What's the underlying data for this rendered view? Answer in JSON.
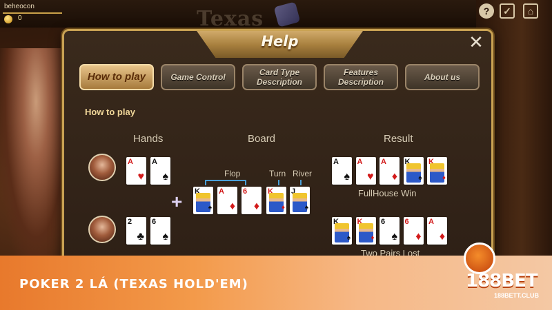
{
  "topbar": {
    "user_name": "beheocon",
    "coin_value": "0",
    "game_title": "Texas"
  },
  "panel": {
    "title": "Help",
    "close_label": "✕",
    "tabs": [
      {
        "label": "How to play",
        "active": true
      },
      {
        "label": "Game Control",
        "active": false
      },
      {
        "label": "Card Type Description",
        "active": false
      },
      {
        "label": "Features Description",
        "active": false
      },
      {
        "label": "About us",
        "active": false
      }
    ],
    "section_heading": "How to play",
    "columns": {
      "hands": "Hands",
      "board": "Board",
      "result": "Result"
    },
    "board_labels": {
      "flop": "Flop",
      "turn": "Turn",
      "river": "River"
    },
    "players": [
      {
        "hand": [
          {
            "rank": "A",
            "suit": "♥",
            "color": "red"
          },
          {
            "rank": "A",
            "suit": "♠",
            "color": "black"
          }
        ],
        "result_cards": [
          {
            "rank": "A",
            "suit": "♠",
            "color": "black"
          },
          {
            "rank": "A",
            "suit": "♥",
            "color": "red"
          },
          {
            "rank": "A",
            "suit": "♦",
            "color": "red"
          },
          {
            "rank": "K",
            "suit": "♠",
            "color": "black",
            "face": true
          },
          {
            "rank": "K",
            "suit": "♦",
            "color": "red",
            "face": true
          }
        ],
        "result_label": "FullHouse  Win"
      },
      {
        "hand": [
          {
            "rank": "2",
            "suit": "♣",
            "color": "black"
          },
          {
            "rank": "6",
            "suit": "♠",
            "color": "black"
          }
        ],
        "result_cards": [
          {
            "rank": "K",
            "suit": "♠",
            "color": "black",
            "face": true
          },
          {
            "rank": "K",
            "suit": "♦",
            "color": "red",
            "face": true
          },
          {
            "rank": "6",
            "suit": "♠",
            "color": "black"
          },
          {
            "rank": "6",
            "suit": "♦",
            "color": "red"
          },
          {
            "rank": "A",
            "suit": "♦",
            "color": "red"
          }
        ],
        "result_label": "Two Pairs  Lost"
      }
    ],
    "board_cards": [
      {
        "rank": "K",
        "suit": "♠",
        "color": "black",
        "face": true
      },
      {
        "rank": "A",
        "suit": "♦",
        "color": "red"
      },
      {
        "rank": "6",
        "suit": "♦",
        "color": "red"
      },
      {
        "rank": "K",
        "suit": "♦",
        "color": "red",
        "face": true
      },
      {
        "rank": "J",
        "suit": "♠",
        "color": "black",
        "face": true
      }
    ]
  },
  "banner": {
    "title": "POKER 2 LÁ (TEXAS HOLD'EM)",
    "brand": "188BET",
    "brand_url": "188BETT.CLUB"
  },
  "colors": {
    "panel_border": "#c9a253",
    "tab_active": "#e8c48a",
    "banner_start": "#e8792c",
    "bracket": "#4aa0d8"
  }
}
